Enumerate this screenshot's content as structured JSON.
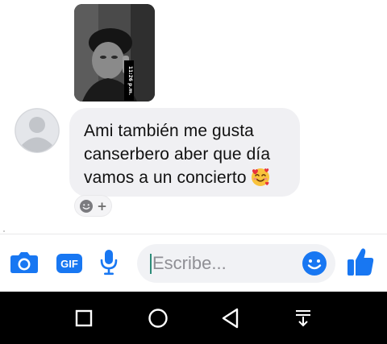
{
  "conversation": {
    "message_lines": [
      "Ami también me gusta",
      "canserbero aber que día",
      "vamos a un concierto"
    ],
    "photo_stamp": "11:26 p.m."
  },
  "composer": {
    "placeholder": "Escribe...",
    "gif_label": "GIF",
    "add_reaction": "+"
  },
  "icons": {
    "camera": "camera-icon",
    "gif": "gif-icon",
    "microphone": "microphone-icon",
    "emoji": "emoji-icon",
    "like": "thumbs-up-icon",
    "nav_back": "back-triangle-icon",
    "nav_home": "home-circle-icon",
    "nav_recents": "recents-square-icon"
  },
  "colors": {
    "messenger_blue": "#1877f2",
    "bubble": "#f0f0f3",
    "nav_bar": "#000000"
  }
}
